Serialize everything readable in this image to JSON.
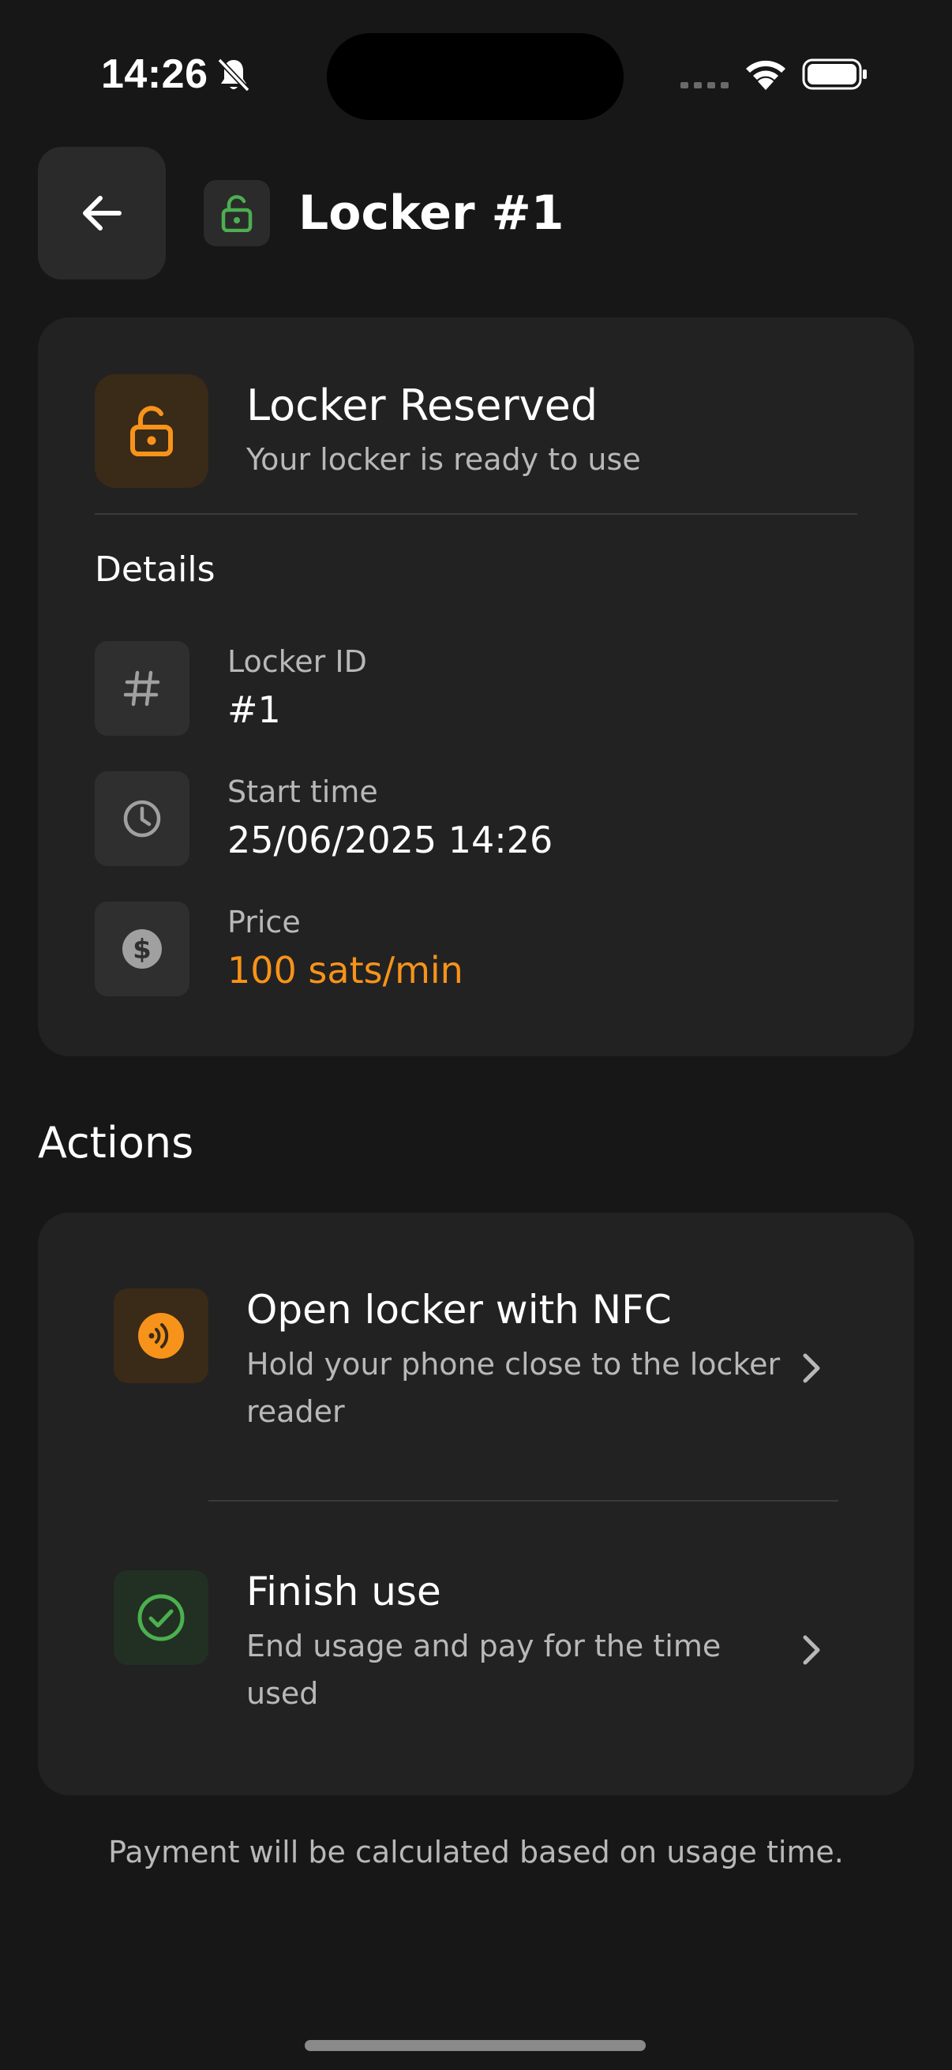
{
  "status_bar": {
    "time": "14:26"
  },
  "header": {
    "title": "Locker #1"
  },
  "reservation": {
    "title": "Locker Reserved",
    "subtitle": "Your locker is ready to use",
    "details_heading": "Details",
    "details": [
      {
        "icon": "hash-icon",
        "label": "Locker ID",
        "value": "#1"
      },
      {
        "icon": "clock-icon",
        "label": "Start time",
        "value": "25/06/2025 14:26"
      },
      {
        "icon": "dollar-icon",
        "label": "Price",
        "value": "100 sats/min"
      }
    ]
  },
  "actions": {
    "heading": "Actions",
    "items": [
      {
        "icon": "nfc-icon",
        "title": "Open locker with NFC",
        "description": "Hold your phone close to the locker reader"
      },
      {
        "icon": "check-circle-icon",
        "title": "Finish use",
        "description": "End usage and pay for the time used"
      }
    ]
  },
  "footer": {
    "note": "Payment will be calculated based on usage time."
  },
  "colors": {
    "background": "#171717",
    "card": "#222222",
    "accent_orange": "#f7931a",
    "accent_green": "#4caf50",
    "muted_text": "#b8b8b8"
  }
}
